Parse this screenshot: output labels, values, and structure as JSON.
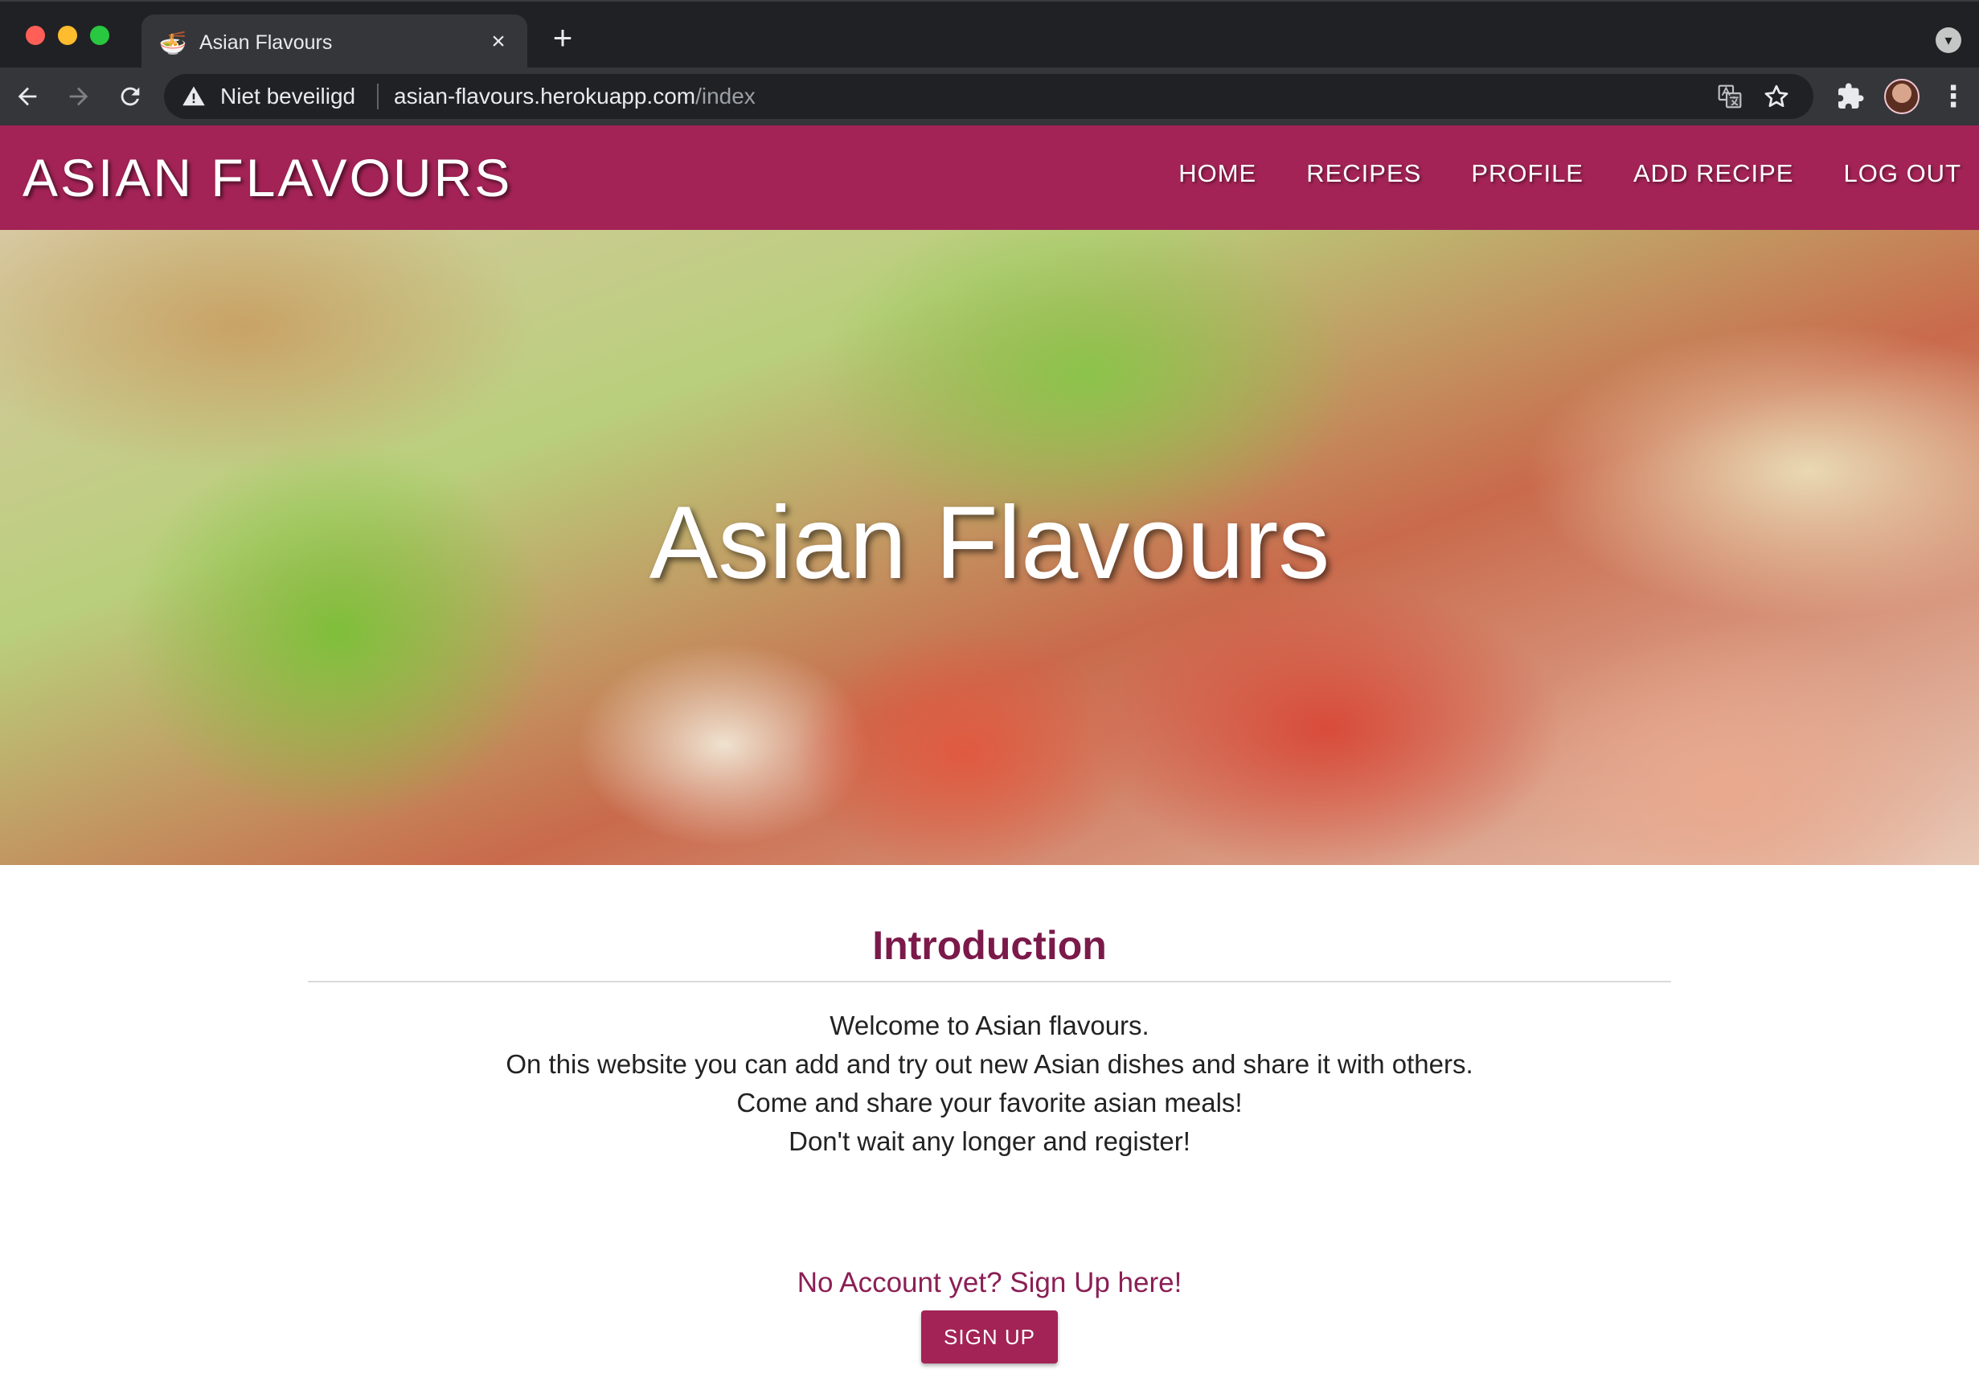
{
  "browser": {
    "tab": {
      "favicon": "ramen-bowl-icon",
      "title": "Asian Flavours",
      "close": "×"
    },
    "new_tab": "+",
    "tab_search": "chevron-down-icon",
    "omnibox": {
      "security_text": "Niet beveiligd",
      "url_host": "asian-flavours.herokuapp.com",
      "url_path": "/index"
    },
    "kebab": "⋮"
  },
  "site": {
    "brand": "ASIAN FLAVOURS",
    "nav": [
      "HOME",
      "RECIPES",
      "PROFILE",
      "ADD RECIPE",
      "LOG OUT"
    ],
    "hero_title": "Asian Flavours",
    "intro": {
      "heading": "Introduction",
      "lines": [
        "Welcome to Asian flavours.",
        "On this website you can add and try out new Asian dishes and share it with others.",
        "Come and share your favorite asian meals!",
        "Don't wait any longer and register!"
      ],
      "signup_prompt": "No Account yet? Sign Up here!",
      "signup_button": "SIGN UP"
    }
  },
  "colors": {
    "brand": "#a32356",
    "heading": "#7b1a4a",
    "chrome_dark": "#202124",
    "chrome_mid": "#35363a"
  }
}
